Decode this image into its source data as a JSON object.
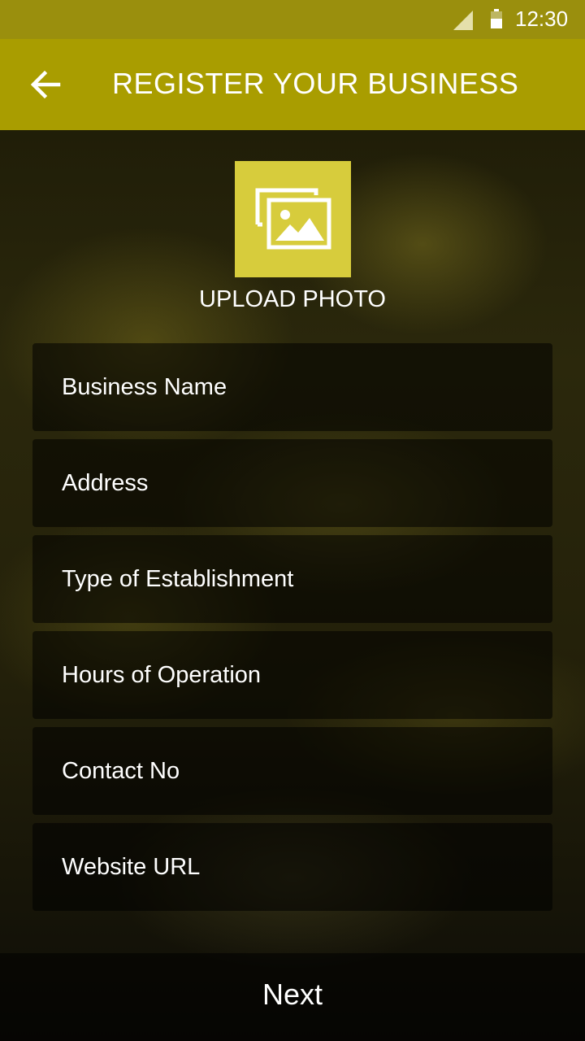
{
  "status_bar": {
    "time": "12:30",
    "icons": [
      "signal-icon",
      "battery-icon"
    ]
  },
  "app_bar": {
    "back_icon": "arrow-left-icon",
    "title": "REGISTER YOUR BUSINESS"
  },
  "upload": {
    "icon": "photo-gallery-icon",
    "label": "UPLOAD PHOTO"
  },
  "form": {
    "fields": [
      {
        "placeholder": "Business Name"
      },
      {
        "placeholder": "Address"
      },
      {
        "placeholder": "Type of Establishment"
      },
      {
        "placeholder": "Hours of Operation"
      },
      {
        "placeholder": "Contact No"
      },
      {
        "placeholder": "Website URL"
      }
    ]
  },
  "footer": {
    "next_label": "Next"
  },
  "colors": {
    "status_bar": "#9a8f0d",
    "app_bar": "#a99d00",
    "upload_tile": "#d7cc3c"
  }
}
